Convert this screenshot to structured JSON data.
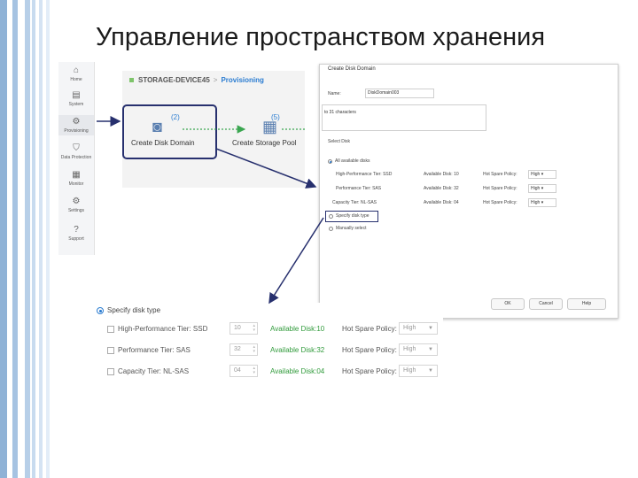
{
  "slide": {
    "title": "Управление пространством хранения"
  },
  "sidebar": {
    "items": [
      {
        "label": "Home",
        "icon": "home-icon",
        "glyph": "⌂"
      },
      {
        "label": "System",
        "icon": "server-icon",
        "glyph": "▤"
      },
      {
        "label": "Provisioning",
        "icon": "provisioning-gear-icon",
        "glyph": "⚙"
      },
      {
        "label": "Data Protection",
        "icon": "shield-icon",
        "glyph": "⛉"
      },
      {
        "label": "Monitor",
        "icon": "monitor-icon",
        "glyph": "▦"
      },
      {
        "label": "Settings",
        "icon": "settings-icon",
        "glyph": "⚙"
      },
      {
        "label": "Support",
        "icon": "support-icon",
        "glyph": "?"
      }
    ]
  },
  "breadcrumb": {
    "device": "STORAGE-DEVICE45",
    "separator": ">",
    "section": "Provisioning"
  },
  "steps": [
    {
      "number": "2",
      "label": "Create Disk Domain",
      "icon": "disk-domain-icon",
      "glyph": "◙"
    },
    {
      "number": "5",
      "label": "Create Storage Pool",
      "icon": "storage-pool-icon",
      "glyph": "▦"
    }
  ],
  "dialog": {
    "title": "Create Disk Domain",
    "name_label": "Name:",
    "name_value": "DiskDomain003",
    "description_value": "to 31 characters",
    "select_disk_label": "Select Disk",
    "options": {
      "all_available": "All available disks",
      "specify_disk_type": "Specify disk type",
      "manually_select": "Manually select"
    },
    "tiers": [
      {
        "name": "High-Performance Tier: SSD",
        "available": "Available Disk: 10",
        "hot_spare_label": "Hot Spare Policy:",
        "policy": "High"
      },
      {
        "name": "Performance Tier: SAS",
        "available": "Available Disk: 32",
        "hot_spare_label": "Hot Spare Policy:",
        "policy": "High"
      },
      {
        "name": "Capacity Tier: NL-SAS",
        "available": "Available Disk: 04",
        "hot_spare_label": "Hot Spare Policy:",
        "policy": "High"
      }
    ],
    "buttons": {
      "ok": "OK",
      "cancel": "Cancel",
      "help": "Help"
    }
  },
  "zoom": {
    "header": "Specify disk type",
    "rows": [
      {
        "name": "High-Performance Tier: SSD",
        "count": "10",
        "available": "Available Disk:10",
        "hot_spare_label": "Hot Spare Policy:",
        "policy": "High"
      },
      {
        "name": "Performance Tier: SAS",
        "count": "32",
        "available": "Available Disk:32",
        "hot_spare_label": "Hot Spare Policy:",
        "policy": "High"
      },
      {
        "name": "Capacity Tier: NL-SAS",
        "count": "04",
        "available": "Available Disk:04",
        "hot_spare_label": "Hot Spare Policy:",
        "policy": "High"
      }
    ]
  },
  "colors": {
    "accent": "#2a7cd1",
    "available_green": "#2f9a3a",
    "highlight_frame": "#27306e",
    "arrow": "#27306e"
  }
}
